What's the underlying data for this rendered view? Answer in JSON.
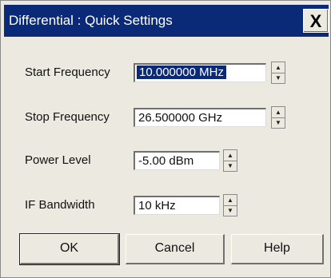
{
  "window": {
    "title": "Differential : Quick Settings",
    "close_glyph": "X"
  },
  "fields": [
    {
      "label": "Start Frequency",
      "value": "10.000000 MHz",
      "selected": true
    },
    {
      "label": "Stop Frequency",
      "value": "26.500000 GHz",
      "selected": false
    },
    {
      "label": "Power Level",
      "value": "-5.00 dBm",
      "selected": false
    },
    {
      "label": "IF Bandwidth",
      "value": "10 kHz",
      "selected": false
    }
  ],
  "buttons": {
    "ok": "OK",
    "cancel": "Cancel",
    "help": "Help"
  },
  "icons": {
    "spin_up": "up-arrow-icon",
    "spin_down": "down-arrow-icon",
    "close": "close-icon"
  },
  "colors": {
    "titlebar": "#0a2a78",
    "dialog_bg": "#ece9e1",
    "selection": "#0a2a78"
  }
}
